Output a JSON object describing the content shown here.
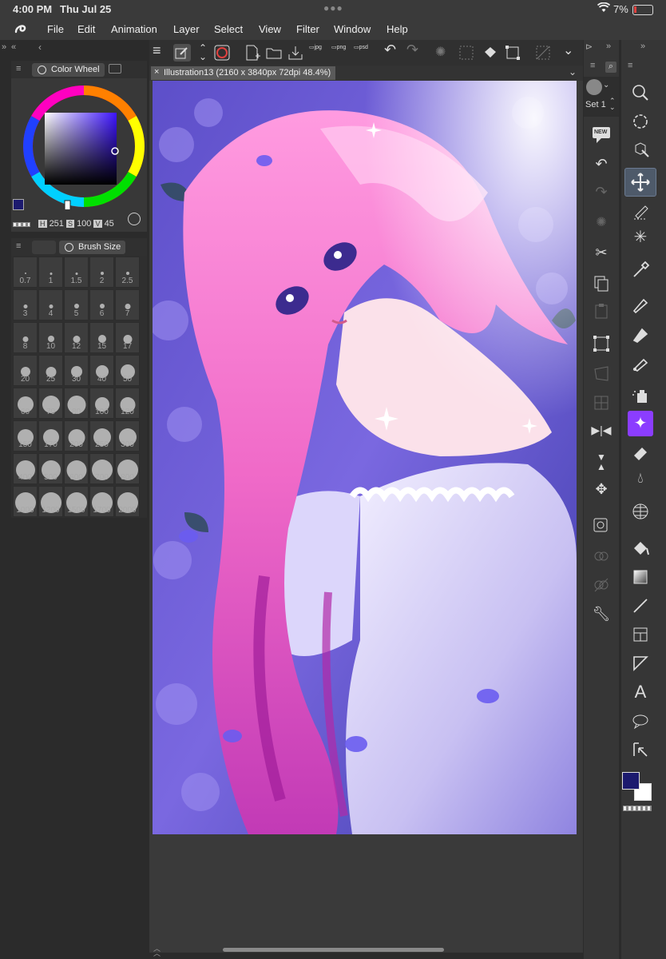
{
  "status": {
    "time": "4:00 PM",
    "date": "Thu Jul 25",
    "battery": "7%"
  },
  "menu": [
    "File",
    "Edit",
    "Animation",
    "Layer",
    "Select",
    "View",
    "Filter",
    "Window",
    "Help"
  ],
  "color_panel": {
    "tab_label": "Color Wheel",
    "h_label": "H",
    "h_value": "251",
    "s_label": "S",
    "s_value": "100",
    "v_label": "V",
    "v_value": "45",
    "main_color": "#1c1a6e",
    "sub_color": "#ffffff"
  },
  "brush_panel": {
    "tab_label": "Brush Size",
    "sizes": [
      "0.7",
      "1",
      "1.5",
      "2",
      "2.5",
      "3",
      "4",
      "5",
      "6",
      "7",
      "8",
      "10",
      "12",
      "15",
      "17",
      "20",
      "25",
      "30",
      "40",
      "50",
      "60",
      "70",
      "80",
      "100",
      "120",
      "150",
      "170",
      "200",
      "250",
      "300",
      "400",
      "500",
      "600",
      "700",
      "800",
      "1000",
      "1200",
      "1500",
      "1700",
      "2000"
    ]
  },
  "document": {
    "tab_title": "Illustration13 (2160 x 3840px 72dpi 48.4%)"
  },
  "subtool": {
    "set_label": "Set 1",
    "new_badge": "NEW"
  },
  "tools": {
    "text_tool_glyph": "A"
  }
}
